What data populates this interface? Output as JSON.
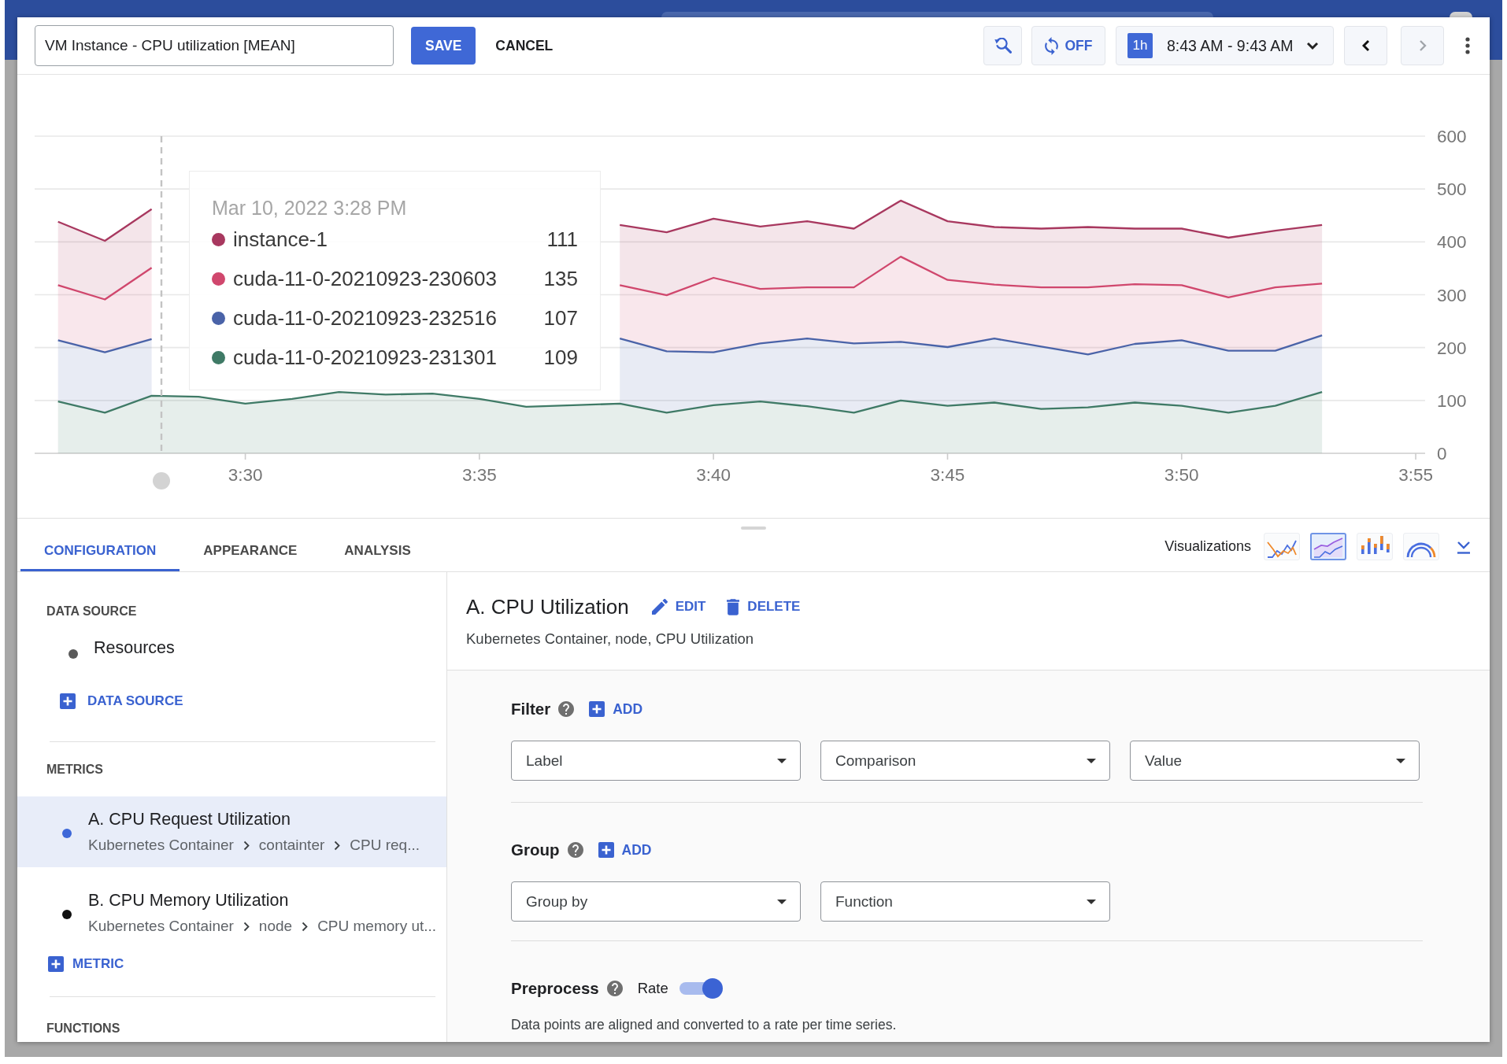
{
  "toolbar": {
    "title_field": {
      "value": "VM Instance - CPU utilization [MEAN]"
    },
    "buttons": [
      {
        "kind": "save",
        "label": "SAVE"
      },
      {
        "kind": "cancel",
        "label": "CANCEL"
      }
    ],
    "auto_refresh": {
      "label": "OFF"
    },
    "time_range": {
      "badge": "1h",
      "label": "8:43 AM - 9:43 AM"
    },
    "nav": [
      {
        "kind": "previous",
        "disabled": false
      },
      {
        "kind": "next",
        "disabled": true
      }
    ]
  },
  "chart": {
    "chart_data": {
      "type": "area",
      "stacked": true,
      "grid": true,
      "categories": [
        null,
        null,
        null,
        null,
        "3:30",
        null,
        null,
        null,
        null,
        "3:35",
        null,
        null,
        null,
        null,
        "3:40",
        null,
        null,
        null,
        null,
        "3:45",
        null,
        null,
        null,
        null,
        "3:50",
        null,
        null,
        null,
        null,
        "3:55"
      ],
      "ylim": [
        0,
        600
      ],
      "yticks": [
        0,
        100,
        200,
        300,
        400,
        500,
        600
      ],
      "series": [
        {
          "name": "cuda-11-0-20210923-231301",
          "color": "#3f7a66",
          "values": [
            98,
            77,
            109,
            107,
            94,
            103,
            116,
            111,
            113,
            103,
            88,
            91,
            94,
            77,
            91,
            98,
            89,
            77,
            100,
            90,
            96,
            84,
            87,
            96,
            90,
            77,
            90,
            116,
            null,
            null
          ]
        },
        {
          "name": "cuda-11-0-20210923-232516",
          "color": "#4a63a8",
          "values": [
            116,
            114,
            107,
            null,
            null,
            null,
            null,
            null,
            null,
            null,
            null,
            null,
            123,
            116,
            100,
            110,
            128,
            131,
            111,
            111,
            121,
            118,
            100,
            111,
            124,
            117,
            104,
            107,
            null,
            null
          ]
        },
        {
          "name": "cuda-11-0-20210923-230603",
          "color": "#d0476d",
          "values": [
            104,
            100,
            135,
            null,
            null,
            null,
            null,
            null,
            null,
            null,
            null,
            null,
            101,
            106,
            141,
            103,
            97,
            106,
            161,
            127,
            102,
            112,
            127,
            113,
            104,
            101,
            120,
            98,
            null,
            null
          ]
        },
        {
          "name": "instance-1",
          "color": "#a8385f",
          "values": [
            120,
            111,
            111,
            null,
            null,
            null,
            null,
            null,
            null,
            null,
            null,
            null,
            114,
            119,
            112,
            118,
            125,
            111,
            106,
            111,
            109,
            111,
            114,
            105,
            107,
            113,
            107,
            111,
            null,
            null
          ]
        }
      ]
    },
    "tooltip": {
      "title": "Mar 10, 2022 3:28 PM",
      "values": [
        "111",
        "135",
        "107",
        "109"
      ]
    }
  },
  "tabs": [
    {
      "label": "CONFIGURATION",
      "selected": true
    },
    {
      "label": "APPEARANCE",
      "selected": false
    },
    {
      "label": "ANALYSIS",
      "selected": false
    }
  ],
  "visualizations": {
    "label": "Visualizations",
    "options": [
      {
        "kind": "line",
        "selected": false
      },
      {
        "kind": "area",
        "selected": true
      },
      {
        "kind": "bar",
        "selected": false
      },
      {
        "kind": "gauge",
        "selected": false
      }
    ]
  },
  "sidebar": {
    "data_source": {
      "heading": "DATA SOURCE",
      "items": [
        {
          "label": "Resources"
        }
      ],
      "add_label": "DATA SOURCE"
    },
    "metrics": {
      "heading": "METRICS",
      "items": [
        {
          "title": "A. CPU Request Utilization",
          "path": [
            "Kubernetes Container",
            "containter",
            "CPU req..."
          ],
          "selected": true
        },
        {
          "title": "B. CPU Memory Utilization",
          "path": [
            "Kubernetes Container",
            "node",
            "CPU memory ut..."
          ],
          "selected": false
        }
      ],
      "add_label": "METRIC"
    },
    "functions": {
      "heading": "FUNCTIONS"
    }
  },
  "query": {
    "title": "A. CPU Utilization",
    "actions": [
      {
        "kind": "edit",
        "label": "EDIT"
      },
      {
        "kind": "delete",
        "label": "DELETE"
      }
    ],
    "subtitle": "Kubernetes Container, node, CPU Utilization",
    "sections": [
      {
        "kind": "filter",
        "title": "Filter",
        "add_label": "ADD",
        "dropdowns": [
          {
            "placeholder": "Label"
          },
          {
            "placeholder": "Comparison"
          },
          {
            "placeholder": "Value"
          }
        ]
      },
      {
        "kind": "group",
        "title": "Group",
        "add_label": "ADD",
        "dropdowns": [
          {
            "placeholder": "Group by"
          },
          {
            "placeholder": "Function"
          }
        ]
      },
      {
        "kind": "preprocess",
        "title": "Preprocess",
        "toggle": {
          "label": "Rate",
          "on": true
        },
        "description": "Data points are aligned and converted to a rate per time series."
      }
    ]
  }
}
